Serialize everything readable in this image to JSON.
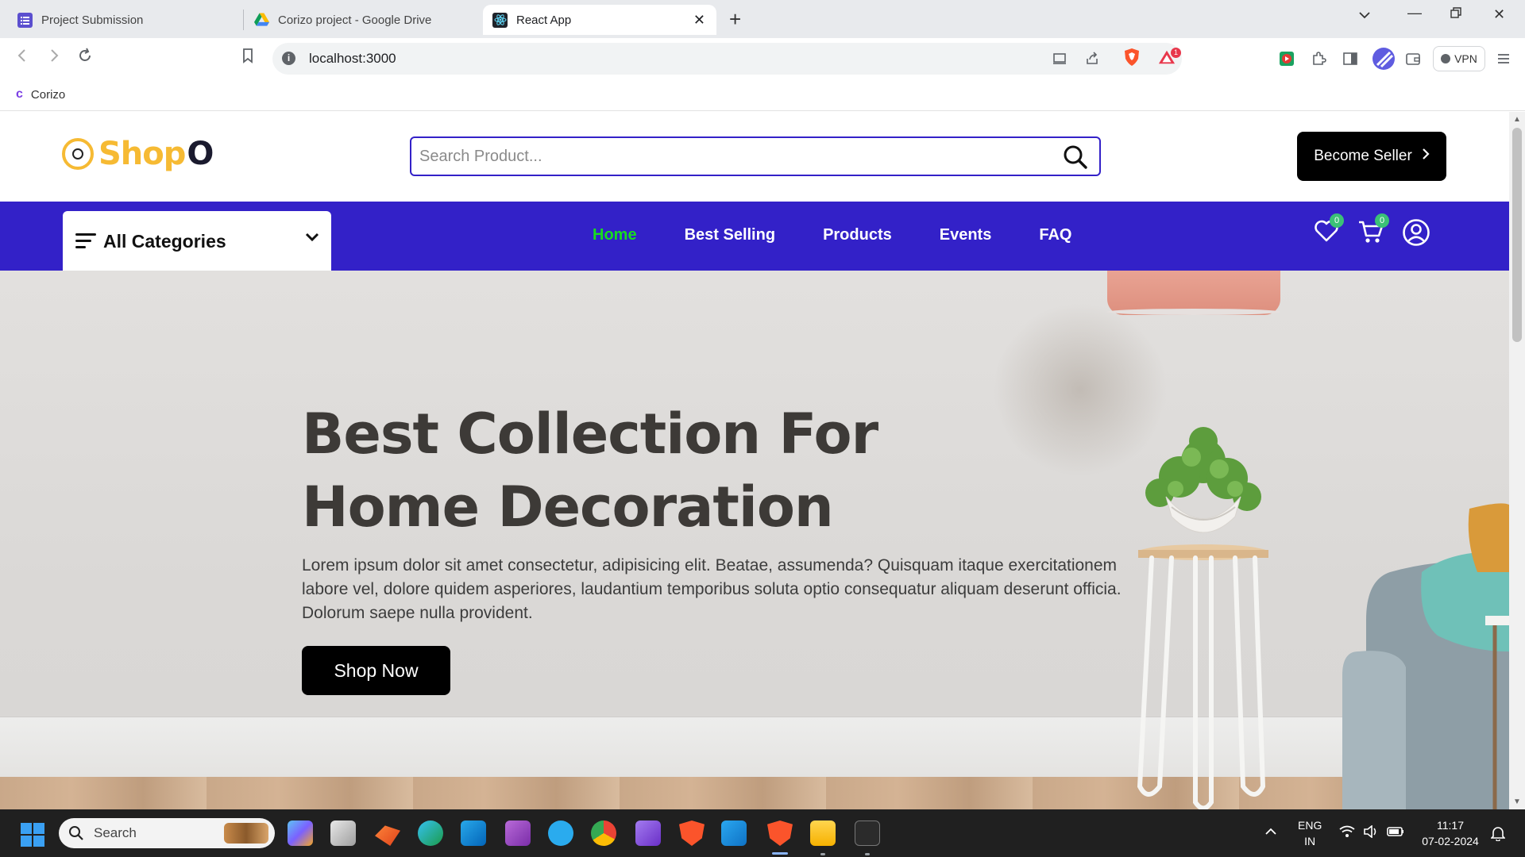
{
  "browser": {
    "tabs": [
      {
        "title": "Project Submission",
        "active": false
      },
      {
        "title": "Corizo project - Google Drive",
        "active": false
      },
      {
        "title": "React App",
        "active": true
      }
    ],
    "url": "localhost:3000",
    "vpn_label": "VPN",
    "brave_badge": "1",
    "bookmarks": [
      {
        "label": "Corizo"
      }
    ]
  },
  "site": {
    "logo_text": "Shop",
    "logo_suffix": "O",
    "search_placeholder": "Search Product...",
    "become_seller": "Become Seller",
    "categories_label": "All Categories",
    "nav": [
      "Home",
      "Best Selling",
      "Products",
      "Events",
      "FAQ"
    ],
    "active_nav": "Home",
    "wishlist_count": "0",
    "cart_count": "0",
    "colors": {
      "brand_blue": "#3321c8",
      "accent_yellow": "#f6ba33",
      "active_green": "#17dd1f",
      "badge_green": "#3bc177"
    }
  },
  "hero": {
    "title_line1": "Best Collection For",
    "title_line2": "Home Decoration",
    "description": "Lorem ipsum dolor sit amet consectetur, adipisicing elit. Beatae, assumenda? Quisquam itaque exercitationem labore vel, dolore quidem asperiores, laudantium temporibus soluta optio consequatur aliquam deserunt officia. Dolorum saepe nulla provident.",
    "cta": "Shop Now"
  },
  "taskbar": {
    "search_label": "Search",
    "language": "ENG",
    "region": "IN",
    "time": "11:17",
    "date": "07-02-2024"
  }
}
